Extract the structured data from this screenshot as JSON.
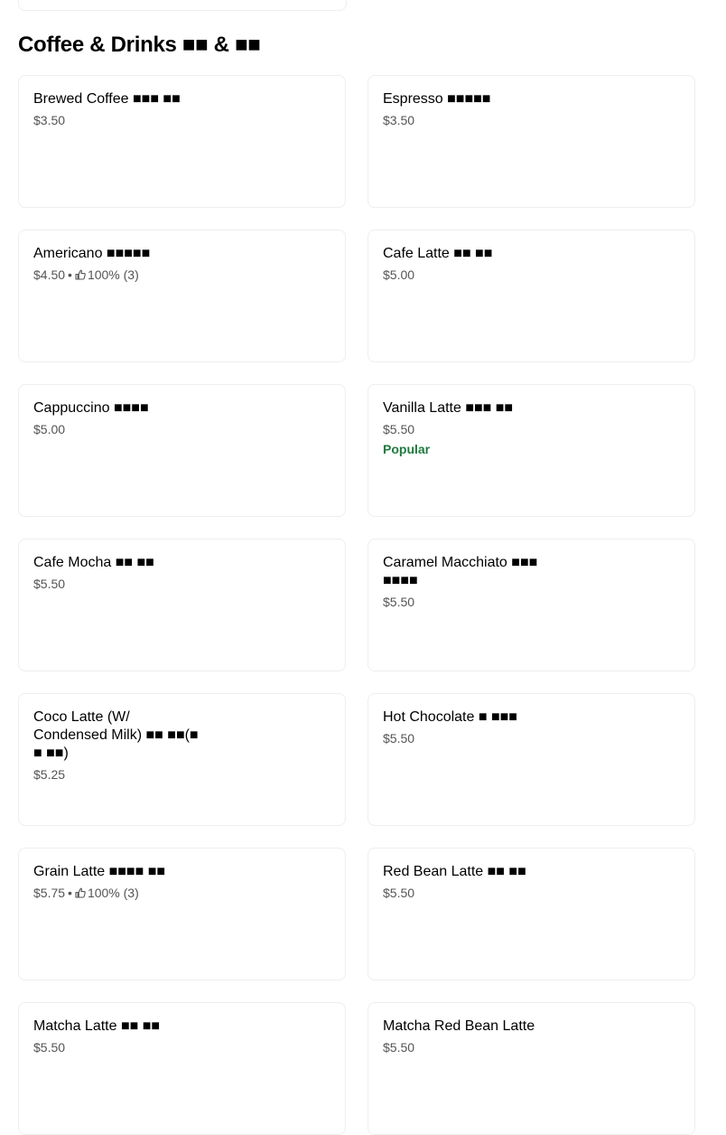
{
  "section": {
    "title": "Coffee & Drinks ■■ & ■■"
  },
  "items": [
    {
      "name": "Brewed Coffee ■■■ ■■",
      "price": "$3.50"
    },
    {
      "name": "Espresso ■■■■■",
      "price": "$3.50"
    },
    {
      "name": "Americano ■■■■■",
      "price": "$4.50",
      "separator": "•",
      "rating": "100% (3)"
    },
    {
      "name": "Cafe Latte ■■ ■■",
      "price": "$5.00"
    },
    {
      "name": "Cappuccino ■■■■",
      "price": "$5.00"
    },
    {
      "name": "Vanilla Latte ■■■ ■■",
      "price": "$5.50",
      "badge": "Popular"
    },
    {
      "name": "Cafe Mocha ■■ ■■",
      "price": "$5.50"
    },
    {
      "name": "Caramel Macchiato ■■■ ■■■■",
      "price": "$5.50"
    },
    {
      "name": "Coco Latte (W/ Condensed Milk) ■■ ■■(■ ■ ■■)",
      "price": "$5.25"
    },
    {
      "name": "Hot Chocolate ■ ■■■",
      "price": "$5.50"
    },
    {
      "name": "Grain Latte ■■■■ ■■",
      "price": "$5.75",
      "separator": "•",
      "rating": "100% (3)"
    },
    {
      "name": "Red Bean Latte ■■ ■■",
      "price": "$5.50"
    },
    {
      "name": "Matcha Latte ■■ ■■",
      "price": "$5.50"
    },
    {
      "name": "Matcha Red Bean Latte",
      "price": "$5.50"
    }
  ],
  "colors": {
    "popular": "#1f7a3e",
    "meta_text": "#545454",
    "card_border": "#eeeeee"
  },
  "icons": {
    "rating": "thumbs-up-icon"
  }
}
